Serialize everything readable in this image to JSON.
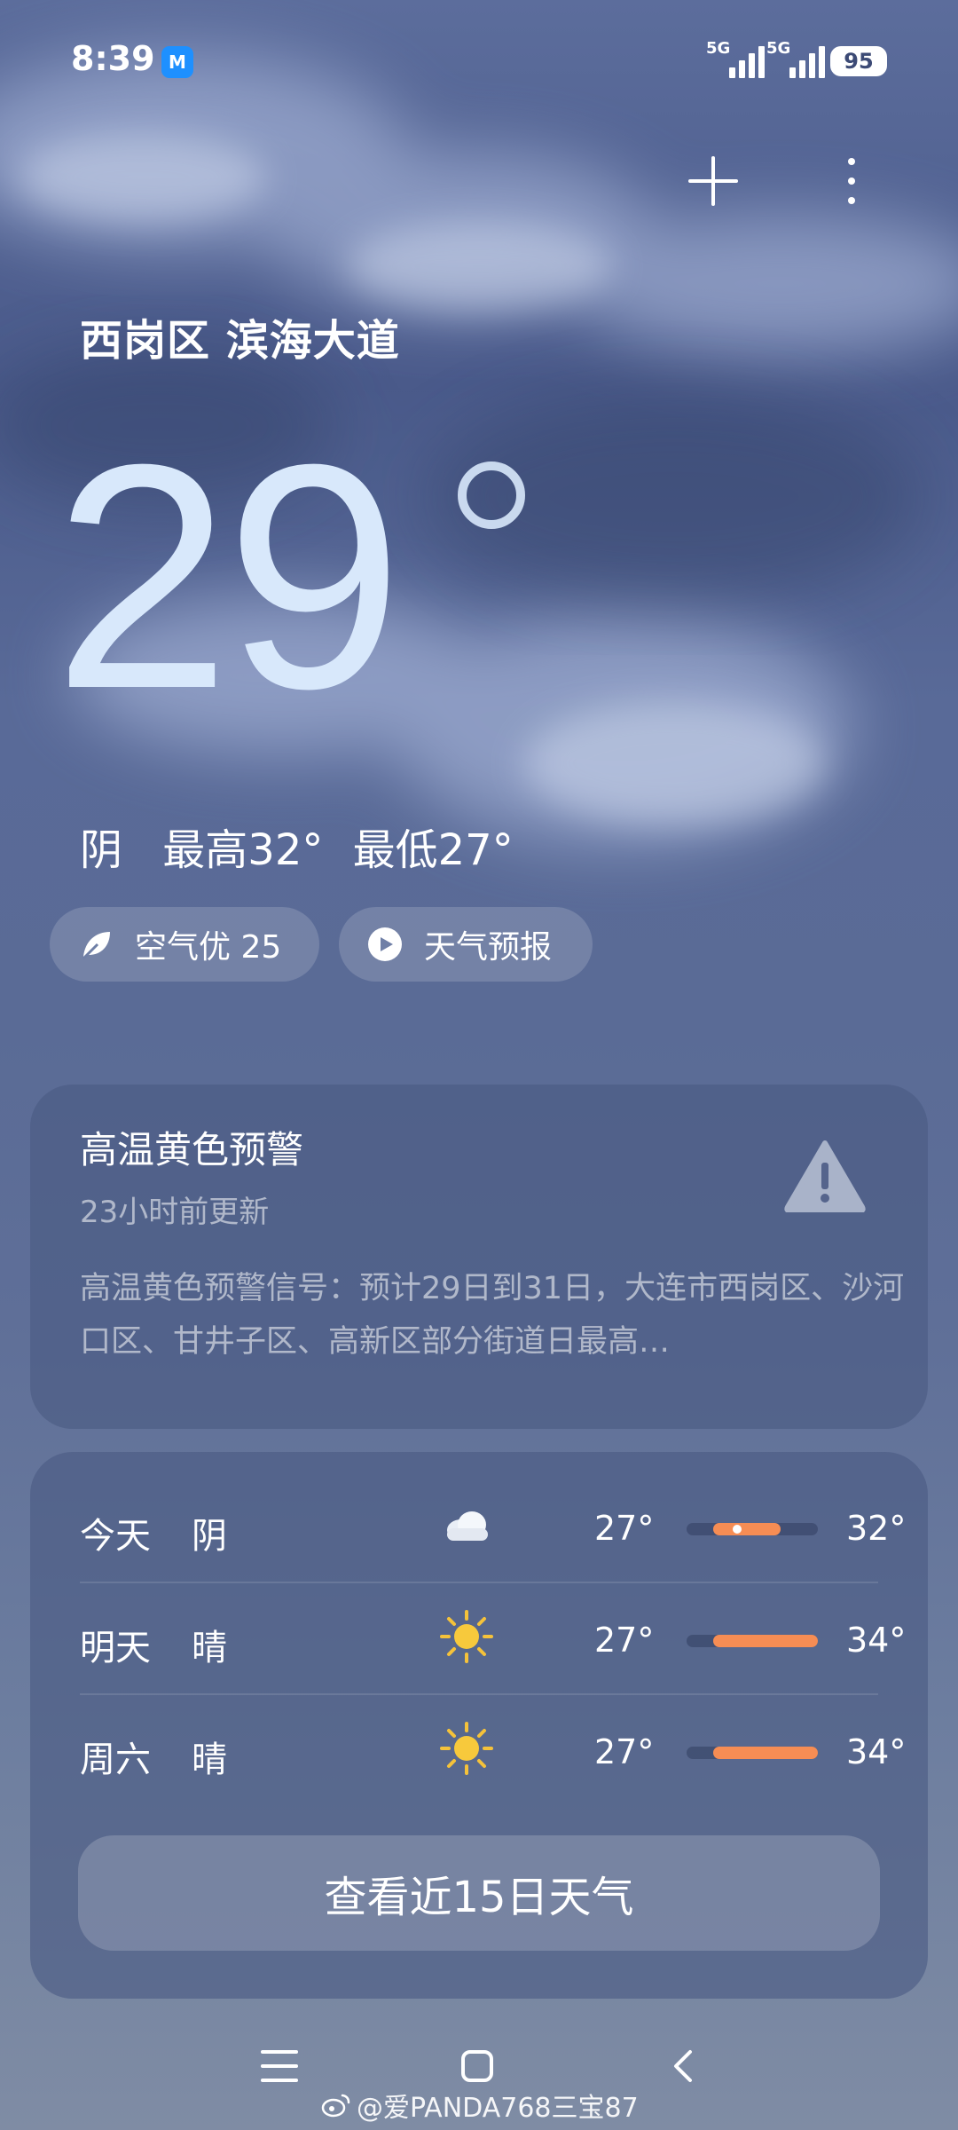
{
  "status_bar": {
    "time": "8:39",
    "app_badge": "M",
    "signal_1": "5G",
    "signal_2": "5G",
    "battery": "95"
  },
  "header": {
    "plus_icon": "plus-icon",
    "more_icon": "more-vertical-icon"
  },
  "location": "西岗区 滨海大道",
  "current": {
    "temperature": "29",
    "condition": "阴",
    "high": "最高32°",
    "low": "最低27°"
  },
  "chips": {
    "air_quality": "空气优 25",
    "air_icon": "leaf-icon",
    "forecast_video": "天气预报",
    "forecast_icon": "play-icon"
  },
  "alert": {
    "title": "高温黄色预警",
    "updated": "23小时前更新",
    "body": "高温黄色预警信号：预计29日到31日，大连市西岗区、沙河口区、甘井子区、高新区部分街道日最高…",
    "icon": "warning-triangle-icon"
  },
  "forecast": {
    "scale": {
      "min": 27,
      "max": 34
    },
    "days": [
      {
        "day": "今天",
        "weather": "阴",
        "icon": "cloud-icon",
        "low": "27°",
        "high": "32°",
        "low_value": 27,
        "high_value": 32,
        "current_value": 29
      },
      {
        "day": "明天",
        "weather": "晴",
        "icon": "sun-icon",
        "low": "27°",
        "high": "34°",
        "low_value": 27,
        "high_value": 34
      },
      {
        "day": "周六",
        "weather": "晴",
        "icon": "sun-icon",
        "low": "27°",
        "high": "34°",
        "low_value": 27,
        "high_value": 34
      }
    ],
    "more_button": "查看近15日天气"
  },
  "watermark": "@爱PANDA768三宝87",
  "colors": {
    "accent": "#f68d54",
    "temp_text": "#d8e8fb"
  }
}
